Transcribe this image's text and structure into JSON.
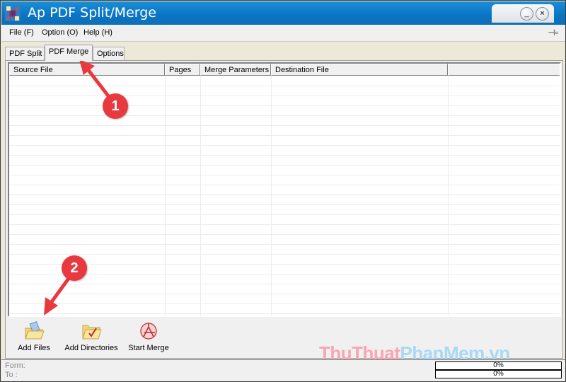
{
  "window": {
    "title": "Ap PDF Split/Merge",
    "minimize_label": "_",
    "close_label": "×"
  },
  "menubar": {
    "items": [
      {
        "label": "File (F)"
      },
      {
        "label": "Option (O)"
      },
      {
        "label": "Help (H)"
      }
    ]
  },
  "tabs": [
    {
      "label": "PDF Split",
      "active": false
    },
    {
      "label": "PDF Merge",
      "active": true
    },
    {
      "label": "Options",
      "active": false
    }
  ],
  "table": {
    "columns": [
      {
        "label": "Source File"
      },
      {
        "label": "Pages"
      },
      {
        "label": "Merge Parameters"
      },
      {
        "label": "Destination File"
      },
      {
        "label": ""
      }
    ],
    "rows": []
  },
  "toolbar": {
    "buttons": [
      {
        "label": "Add Files",
        "icon": "folder-open-file-icon"
      },
      {
        "label": "Add Directories",
        "icon": "folder-check-icon"
      },
      {
        "label": "Start Merge",
        "icon": "acrobat-icon"
      }
    ]
  },
  "status": {
    "form_label": "Form:",
    "to_label": "To  :",
    "progress_form": {
      "value": 0,
      "text": "0%"
    },
    "progress_to": {
      "value": 0,
      "text": "0%"
    }
  },
  "annotations": {
    "badge1": "1",
    "badge2": "2"
  },
  "watermark": {
    "part1": "ThuThuat",
    "part2": "PhanMem.vn"
  },
  "colors": {
    "titlebar": "#0a74c4",
    "annotation_red": "#e8393f",
    "watermark_pink": "#f7a6b2",
    "watermark_blue": "#a7d9f5"
  }
}
